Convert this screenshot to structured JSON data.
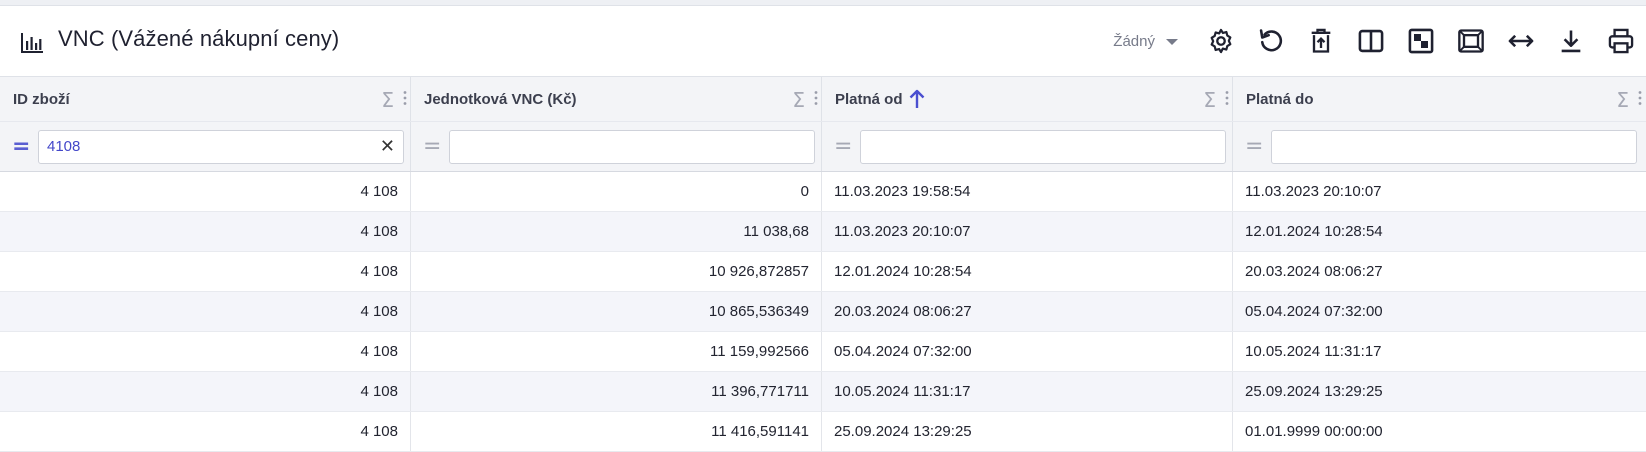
{
  "header": {
    "title": "VNC (Vážené nákupní ceny)",
    "title_icon": "bar-chart-icon",
    "view_select": {
      "value": "Žádný"
    },
    "toolbar": [
      {
        "name": "settings-button",
        "icon": "gear-icon"
      },
      {
        "name": "reset-button",
        "icon": "undo-icon"
      },
      {
        "name": "delete-export-button",
        "icon": "trash-upload-icon"
      },
      {
        "name": "split-view-button",
        "icon": "split-columns-icon"
      },
      {
        "name": "checker-button",
        "icon": "checkerboard-icon"
      },
      {
        "name": "fit-screen-button",
        "icon": "fit-frame-icon"
      },
      {
        "name": "autosize-columns-button",
        "icon": "horizontal-arrows-icon"
      },
      {
        "name": "download-button",
        "icon": "download-icon"
      },
      {
        "name": "print-button",
        "icon": "printer-icon"
      }
    ]
  },
  "grid": {
    "columns": [
      {
        "label": "ID zboží",
        "sorted": null,
        "filter": "4108"
      },
      {
        "label": "Jednotková VNC (Kč)",
        "sorted": null,
        "filter": ""
      },
      {
        "label": "Platná od",
        "sorted": "asc",
        "filter": ""
      },
      {
        "label": "Platná do",
        "sorted": null,
        "filter": ""
      }
    ],
    "rows": [
      [
        "4 108",
        "0",
        "11.03.2023 19:58:54",
        "11.03.2023 20:10:07"
      ],
      [
        "4 108",
        "11 038,68",
        "11.03.2023 20:10:07",
        "12.01.2024 10:28:54"
      ],
      [
        "4 108",
        "10 926,872857",
        "12.01.2024 10:28:54",
        "20.03.2024 08:06:27"
      ],
      [
        "4 108",
        "10 865,536349",
        "20.03.2024 08:06:27",
        "05.04.2024 07:32:00"
      ],
      [
        "4 108",
        "11 159,992566",
        "05.04.2024 07:32:00",
        "10.05.2024 11:31:17"
      ],
      [
        "4 108",
        "11 396,771711",
        "10.05.2024 11:31:17",
        "25.09.2024 13:29:25"
      ],
      [
        "4 108",
        "11 416,591141",
        "25.09.2024 13:29:25",
        "01.01.9999 00:00:00"
      ]
    ]
  },
  "colors": {
    "accent": "#4a4fd0",
    "icon": "#1f2130",
    "header_bg": "#f3f4f7",
    "alt_row": "#f4f5fa"
  }
}
